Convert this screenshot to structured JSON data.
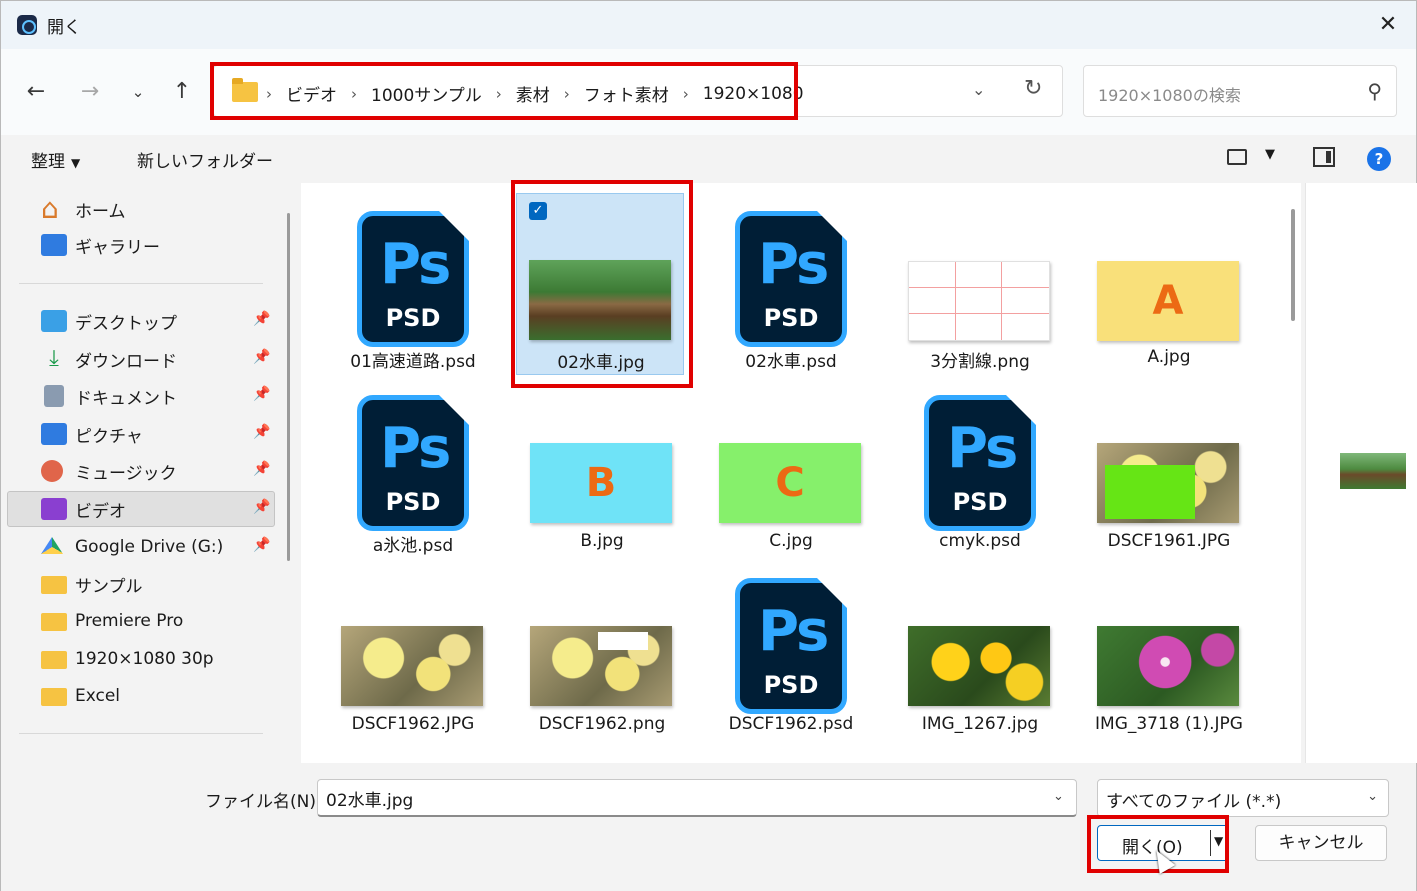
{
  "window": {
    "title": "開く"
  },
  "navigation": {
    "breadcrumbs": [
      "ビデオ",
      "1000サンプル",
      "素材",
      "フォト素材",
      "1920×1080"
    ],
    "search_placeholder": "1920×1080の検索"
  },
  "commands": {
    "organize": "整理",
    "new_folder": "新しいフォルダー"
  },
  "sidebar": {
    "top_items": [
      {
        "label": "ホーム",
        "icon": "home-icon"
      },
      {
        "label": "ギャラリー",
        "icon": "gallery-icon"
      }
    ],
    "pinned_items": [
      {
        "label": "デスクトップ",
        "icon": "desktop-icon"
      },
      {
        "label": "ダウンロード",
        "icon": "download-icon"
      },
      {
        "label": "ドキュメント",
        "icon": "document-icon"
      },
      {
        "label": "ピクチャ",
        "icon": "pictures-icon"
      },
      {
        "label": "ミュージック",
        "icon": "music-icon"
      },
      {
        "label": "ビデオ",
        "icon": "video-icon",
        "selected": true
      },
      {
        "label": "Google Drive (G:)",
        "icon": "google-drive-icon"
      }
    ],
    "folders": [
      {
        "label": "サンプル",
        "icon": "folder-icon"
      },
      {
        "label": "Premiere Pro",
        "icon": "folder-icon"
      },
      {
        "label": "1920×1080 30p",
        "icon": "folder-icon"
      },
      {
        "label": "Excel",
        "icon": "folder-icon"
      }
    ]
  },
  "files": [
    {
      "name": "01高速道路.psd",
      "kind": "psd"
    },
    {
      "name": "02水車.jpg",
      "kind": "photo-water",
      "selected": true
    },
    {
      "name": "02水車.psd",
      "kind": "psd"
    },
    {
      "name": "3分割線.png",
      "kind": "grid"
    },
    {
      "name": "A.jpg",
      "kind": "letter",
      "letter": "A",
      "bg": "#f9e07a"
    },
    {
      "name": "a氷池.psd",
      "kind": "psd"
    },
    {
      "name": "B.jpg",
      "kind": "letter",
      "letter": "B",
      "bg": "#6fe3f7"
    },
    {
      "name": "C.jpg",
      "kind": "letter",
      "letter": "C",
      "bg": "#86f06b"
    },
    {
      "name": "cmyk.psd",
      "kind": "psd"
    },
    {
      "name": "DSCF1961.JPG",
      "kind": "photo-yellow-greenbox"
    },
    {
      "name": "DSCF1962.JPG",
      "kind": "photo-yellow"
    },
    {
      "name": "DSCF1962.png",
      "kind": "photo-yellow-whitebox"
    },
    {
      "name": "DSCF1962.psd",
      "kind": "psd"
    },
    {
      "name": "IMG_1267.jpg",
      "kind": "photo-rose"
    },
    {
      "name": "IMG_3718 (1).JPG",
      "kind": "photo-clem"
    }
  ],
  "psd_icon": {
    "mark": "Ps",
    "label": "PSD"
  },
  "footer": {
    "filename_label": "ファイル名(N):",
    "filename_value": "02水車.jpg",
    "filetype_label": "すべてのファイル (*.*)",
    "open_label": "開く(O)",
    "cancel_label": "キャンセル"
  },
  "colors": {
    "accent": "#0067c0",
    "highlight": "#e00000",
    "selection": "#cce4f7"
  }
}
